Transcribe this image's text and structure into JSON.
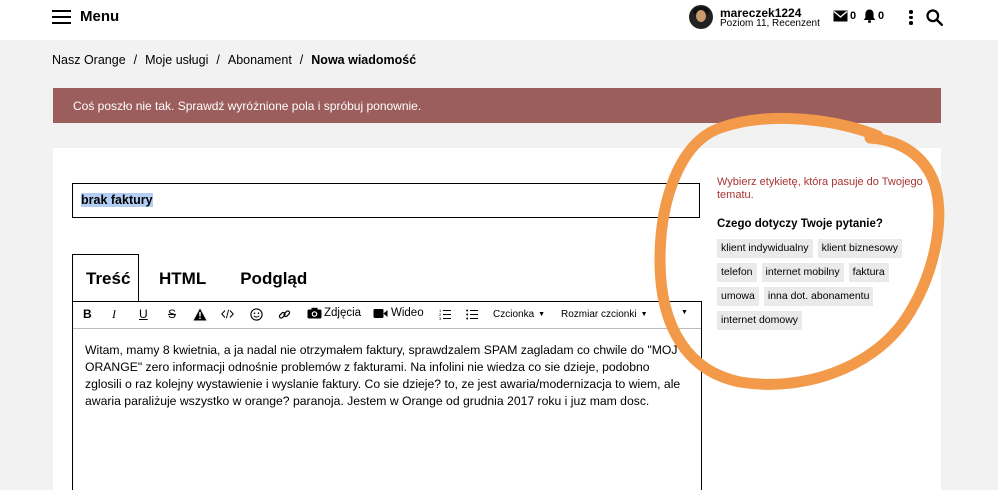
{
  "header": {
    "menu_label": "Menu",
    "user": {
      "name": "mareczek1224",
      "level": "Poziom 11, Recenzent"
    },
    "messages_count": "0",
    "notifications_count": "0"
  },
  "breadcrumb": [
    {
      "label": "Nasz Orange"
    },
    {
      "label": "Moje usługi"
    },
    {
      "label": "Abonament"
    },
    {
      "label": "Nowa wiadomość"
    }
  ],
  "error_message": "Coś poszło nie tak. Sprawdź wyróżnione pola i spróbuj ponownie.",
  "form": {
    "subject_value": "brak faktury",
    "tabs": {
      "content": "Treść",
      "html": "HTML",
      "preview": "Podgląd"
    },
    "toolbar": {
      "bold": "B",
      "italic": "I",
      "underline": "U",
      "strike": "S",
      "photos": "Zdjęcia",
      "video": "Wideo",
      "font": "Czcionka",
      "font_size": "Rozmiar czcionki"
    },
    "body_text": "Witam, mamy 8 kwietnia, a ja nadal nie otrzymałem faktury, sprawdzalem SPAM zagladam co chwile do \"MOJ ORANGE\" zero informacji odnośnie problemów z fakturami. Na infolini nie wiedza co sie dzieje, podobno zglosili o raz kolejny wystawienie i wyslanie faktury. Co sie dzieje? to, ze jest awaria/modernizacja to wiem, ale awaria paraliżuje wszystko w orange? paranoja. Jestem w Orange od grudnia 2017 roku i juz mam dosc."
  },
  "sidebar": {
    "hint": "Wybierz etykietę, która pasuje do Twojego tematu.",
    "question": "Czego dotyczy Twoje pytanie?",
    "tags": [
      "klient indywidualny",
      "klient biznesowy",
      "telefon",
      "internet mobilny",
      "faktura",
      "umowa",
      "inna dot. abonamentu",
      "internet domowy"
    ]
  },
  "colors": {
    "error_bar": "#9c5d5d",
    "hint_text": "#a93434",
    "annotation": "#f39a4a"
  }
}
